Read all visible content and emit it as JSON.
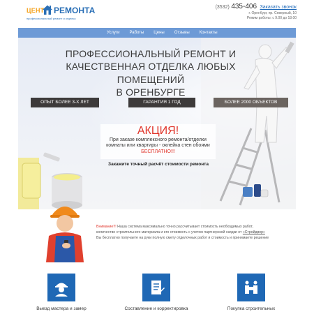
{
  "header": {
    "logo": {
      "word1": "ЦЕНТР",
      "word2": "РЕМОНТА",
      "tagline": "профессиональный ремонт и отделка"
    },
    "contacts": {
      "phone_code": "(3532)",
      "phone_number": "435-406",
      "callback_label": "Заказать звонок",
      "address": "г. Оренбург, пр. Северный, 10",
      "hours": "Режим работы: с 9.00 до 18.00"
    }
  },
  "nav": {
    "items": [
      "Услуги",
      "Работы",
      "Цены",
      "Отзывы",
      "Контакты"
    ]
  },
  "hero": {
    "title_lines": [
      "Профессиональный ремонт и",
      "качественная отделка любых помещений",
      "в Оренбурге"
    ],
    "badges": [
      "Опыт более 3-х лет",
      "Гарантия 1 год",
      "Более 2000 объектов"
    ],
    "promo": {
      "title": "АКЦИЯ!",
      "text": "При заказе комплексного ремонта/отделки комнаты или квартиры - оклейка стен обоями",
      "highlight": "БЕСПЛАТНО!!!"
    },
    "cta_label": "Закажите точный расчёт стоимости ремонта"
  },
  "info": {
    "attention": "Внимание!!!",
    "text_part1": "Наша система максимально точно рассчитывает стоимость необходимых работ, количество строительного материала и его стоимость с учетом партнерской скидки от",
    "link_text": "«Стройдвор»",
    "text_part2": "Вы бесплатно получаете на руки полную смету отделочных работ и стоимость и принимаете решение"
  },
  "steps": [
    {
      "label": "Выезд мастера и замер",
      "icon": "worker-helmet-icon"
    },
    {
      "label": "Составление и корректировка",
      "icon": "document-checklist-icon"
    },
    {
      "label": "Покупка строительных",
      "icon": "delivery-boxes-icon"
    }
  ],
  "colors": {
    "brand_blue": "#1f68b5",
    "nav_blue": "#6d9ad6",
    "accent_red": "#e0342a",
    "logo_orange": "#f4a21c",
    "badge_dark": "#3d3a3a"
  }
}
